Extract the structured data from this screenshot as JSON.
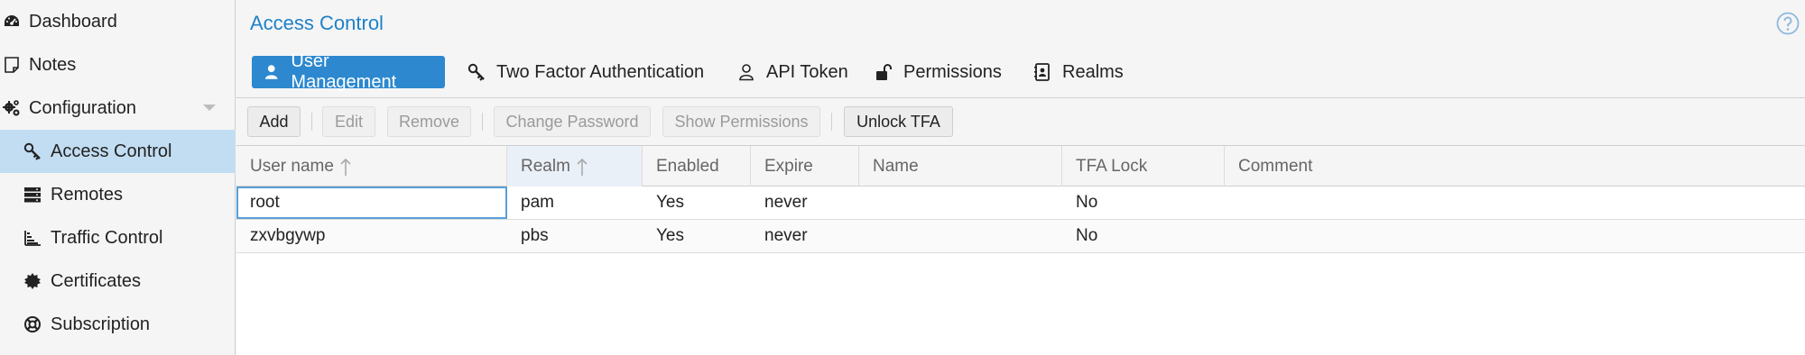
{
  "sidebar": {
    "items": [
      {
        "label": "Dashboard",
        "icon": "dashboard-icon"
      },
      {
        "label": "Notes",
        "icon": "notes-icon"
      },
      {
        "label": "Configuration",
        "icon": "gears-icon"
      },
      {
        "label": "Access Control",
        "icon": "key-icon"
      },
      {
        "label": "Remotes",
        "icon": "server-icon"
      },
      {
        "label": "Traffic Control",
        "icon": "bar-chart-icon"
      },
      {
        "label": "Certificates",
        "icon": "certificate-icon"
      },
      {
        "label": "Subscription",
        "icon": "life-ring-icon"
      }
    ],
    "selected": "Access Control"
  },
  "panel": {
    "title": "Access Control",
    "help_icon": "question-circle-icon"
  },
  "tabs": [
    {
      "label": "User Management",
      "icon": "user-icon",
      "active": true
    },
    {
      "label": "Two Factor Authentication",
      "icon": "key-icon",
      "active": false
    },
    {
      "label": "API Token",
      "icon": "user-outline-icon",
      "active": false
    },
    {
      "label": "Permissions",
      "icon": "unlock-icon",
      "active": false
    },
    {
      "label": "Realms",
      "icon": "address-book-icon",
      "active": false
    }
  ],
  "toolbar": {
    "add": "Add",
    "edit": "Edit",
    "remove": "Remove",
    "change_password": "Change Password",
    "show_permissions": "Show Permissions",
    "unlock_tfa": "Unlock TFA"
  },
  "grid": {
    "columns": [
      "User name",
      "Realm",
      "Enabled",
      "Expire",
      "Name",
      "TFA Lock",
      "Comment"
    ],
    "sorted_columns": [
      "User name",
      "Realm"
    ],
    "rows": [
      [
        "root",
        "pam",
        "Yes",
        "never",
        "",
        "No",
        ""
      ],
      [
        "zxvbgywp",
        "pbs",
        "Yes",
        "never",
        "",
        "No",
        ""
      ]
    ]
  },
  "colors": {
    "accent": "#2d88cf",
    "title": "#1e82c9",
    "selected_nav": "#c2ddf2"
  }
}
